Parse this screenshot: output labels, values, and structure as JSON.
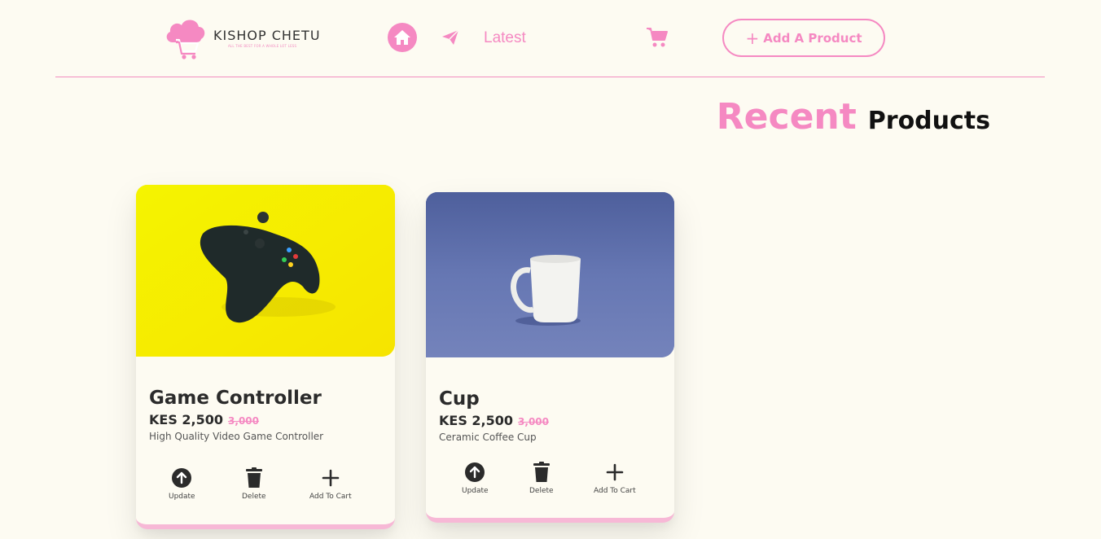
{
  "brand": {
    "name": "KISHOP CHETU",
    "tagline": "ALL THE BEST FOR A WHOLE LOT LESS",
    "color": "#f589c2"
  },
  "nav": {
    "home_icon": "home-icon",
    "send_icon": "paper-plane-icon",
    "latest_label": "Latest",
    "cart_icon": "shopping-cart-icon",
    "add_product_label": "Add A Product"
  },
  "heading": {
    "accent": "Recent",
    "main": "Products"
  },
  "products": [
    {
      "title": "Game Controller",
      "price": "KES 2,500",
      "old_price": "3,000",
      "description": "High Quality Video Game Controller",
      "image": "game-controller-photo",
      "actions": {
        "update": "Update",
        "delete": "Delete",
        "add_to_cart": "Add To Cart"
      }
    },
    {
      "title": "Cup",
      "price": "KES 2,500",
      "old_price": "3,000",
      "description": "Ceramic Coffee Cup",
      "image": "coffee-cup-photo",
      "actions": {
        "update": "Update",
        "delete": "Delete",
        "add_to_cart": "Add To Cart"
      }
    }
  ]
}
